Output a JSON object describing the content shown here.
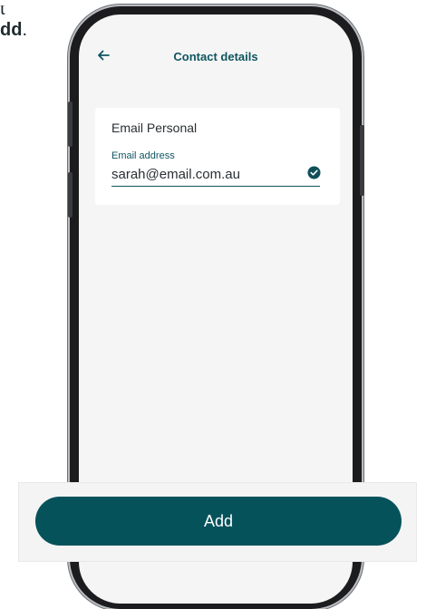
{
  "instruction": {
    "line1_fragment": "t",
    "bold_fragment": "dd",
    "punctuation": "."
  },
  "header": {
    "back_icon": "arrow-left-icon",
    "title": "Contact details"
  },
  "card": {
    "title": "Email Personal",
    "field": {
      "label": "Email address",
      "value": "sarah@email.com.au",
      "status_icon": "check-circle-icon"
    }
  },
  "actions": {
    "add_label": "Add"
  },
  "colors": {
    "accent": "#0f5560",
    "button": "#06525b",
    "screen_bg": "#f5f5f5"
  }
}
